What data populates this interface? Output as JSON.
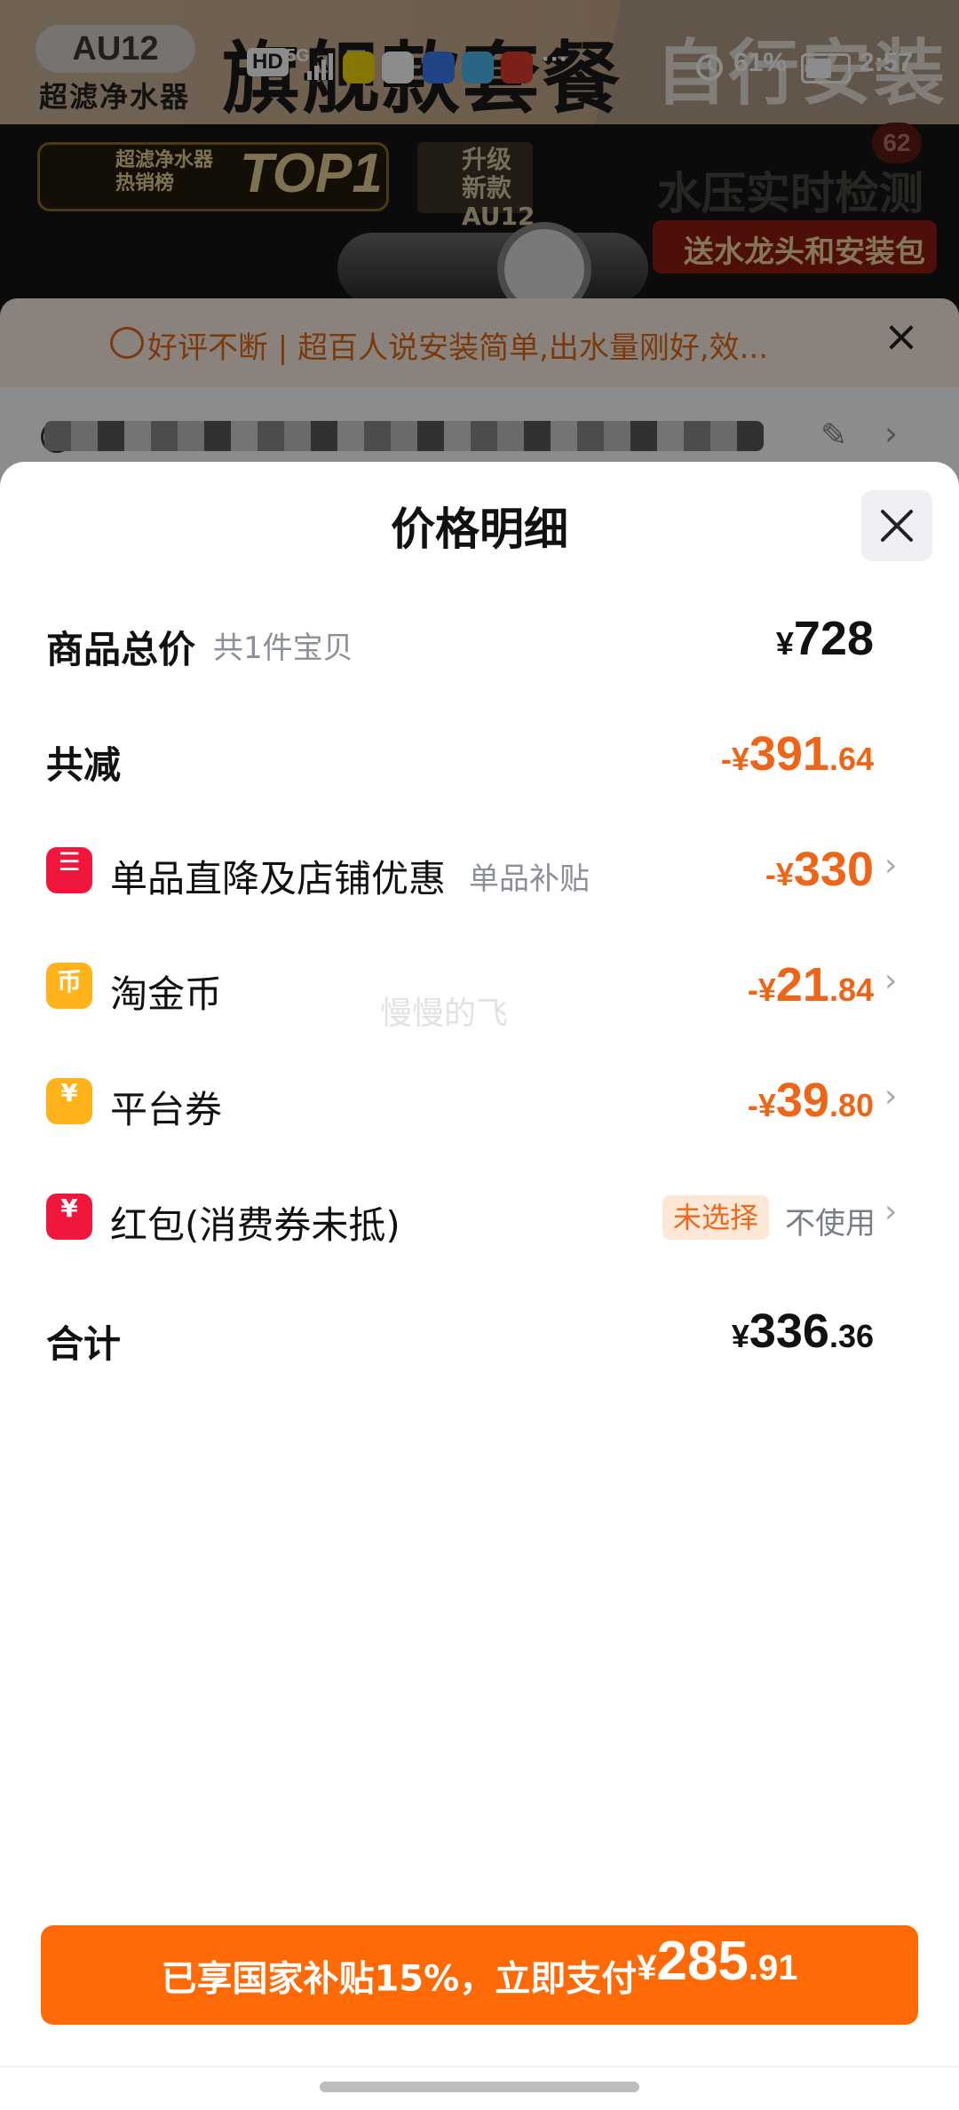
{
  "status_bar": {
    "hd": "HD",
    "network": "5G",
    "more": "···",
    "battery": "61%",
    "time": "2:57"
  },
  "background": {
    "logo": "AU12",
    "logo_sub": "超滤净水器",
    "headline": "旗舰款套餐",
    "headline_right": "自行安装",
    "rank_text": "超滤净水器热销榜",
    "rank_top": "TOP1",
    "upgrade_text": "升级 新款 AU12",
    "water_pressure": "水压实时检测",
    "gift": "送水龙头和安装包",
    "cart_count": "62"
  },
  "review_bar": {
    "text": "好评不断 | 超百人说安装简单,出水量刚好,效..."
  },
  "sheet": {
    "title": "价格明细",
    "rows": {
      "total": {
        "label": "商品总价",
        "sub": "共1件宝贝",
        "sign": "¥",
        "int": "728",
        "dec": ""
      },
      "reduce": {
        "label": "共减",
        "sign": "-¥",
        "int": "391",
        "dec": ".64"
      },
      "single": {
        "label": "单品直降及店铺优惠",
        "sub": "单品补贴",
        "sign": "-¥",
        "int": "330",
        "dec": ""
      },
      "coin": {
        "label": "淘金币",
        "sign": "-¥",
        "int": "21",
        "dec": ".84"
      },
      "coupon": {
        "label": "平台券",
        "sign": "-¥",
        "int": "39",
        "dec": ".80"
      },
      "redpacket": {
        "label": "红包(消费券未抵)",
        "badge": "未选择",
        "action": "不使用"
      },
      "sum": {
        "label": "合计",
        "sign": "¥",
        "int": "336",
        "dec": ".36"
      }
    },
    "watermark": "慢慢的飞",
    "pay_button": {
      "text": "已享国家补贴15%，立即支付",
      "sign": "¥",
      "int": "285",
      "dec": ".91"
    }
  },
  "colors": {
    "accent": "#ff6a06",
    "discount_text": "#ee6518"
  },
  "icons": {
    "single": "shop-discount-icon",
    "coin": "coin-icon",
    "coupon": "coupon-icon",
    "redpacket": "red-packet-icon"
  }
}
